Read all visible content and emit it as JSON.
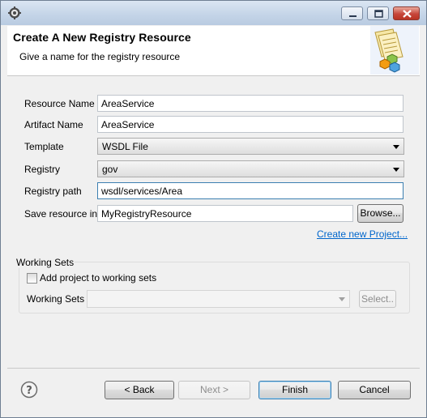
{
  "window": {
    "title": "",
    "controls": [
      "minimize-icon",
      "maximize-icon",
      "close-icon"
    ]
  },
  "header": {
    "title": "Create A New Registry Resource",
    "subtitle": "Give a name for the registry resource"
  },
  "form": {
    "resource_name_label": "Resource Name",
    "resource_name_value": "AreaService",
    "artifact_name_label": "Artifact Name",
    "artifact_name_value": "AreaService",
    "template_label": "Template",
    "template_value": "WSDL File",
    "registry_label": "Registry",
    "registry_value": "gov",
    "registry_path_label": "Registry path",
    "registry_path_value": "wsdl/services/Area",
    "save_in_label": "Save resource in",
    "save_in_value": "MyRegistryResource",
    "browse_label": "Browse...",
    "create_project_link": "Create new Project..."
  },
  "working_sets": {
    "group_title": "Working Sets",
    "checkbox_label": "Add project to working sets",
    "checkbox_checked": false,
    "field_label": "Working Sets",
    "field_value": "",
    "select_label": "Select.."
  },
  "footer": {
    "back_label": "< Back",
    "next_label": "Next >",
    "finish_label": "Finish",
    "cancel_label": "Cancel"
  },
  "colors": {
    "link": "#0066cc",
    "title_bar": "#c5d5e8",
    "close_button": "#c7463a",
    "focus_border": "#3c7fb1"
  }
}
